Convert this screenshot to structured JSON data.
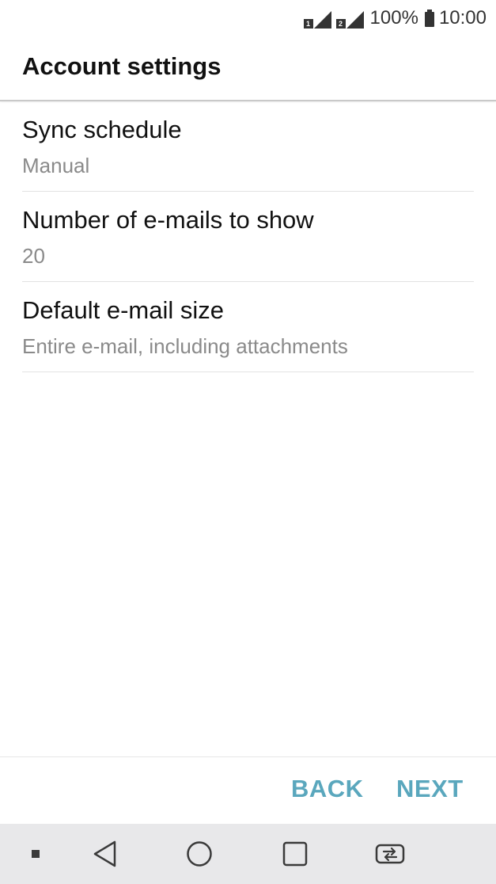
{
  "status_bar": {
    "sim1_label": "1",
    "sim2_label": "2",
    "battery_percent": "100%",
    "time": "10:00"
  },
  "header": {
    "title": "Account settings"
  },
  "settings": [
    {
      "title": "Sync schedule",
      "value": "Manual"
    },
    {
      "title": "Number of e-mails to show",
      "value": "20"
    },
    {
      "title": "Default e-mail size",
      "value": "Entire e-mail, including attachments"
    }
  ],
  "actions": {
    "back_label": "BACK",
    "next_label": "NEXT"
  },
  "nav_bar": {
    "icons": [
      "dot-icon",
      "back-triangle-icon",
      "home-circle-icon",
      "recents-square-icon",
      "dual-window-icon"
    ]
  },
  "colors": {
    "accent": "#5aa7bd",
    "title_text": "#111111",
    "secondary_text": "#8a8a8a",
    "nav_background": "#e8e8ea"
  }
}
